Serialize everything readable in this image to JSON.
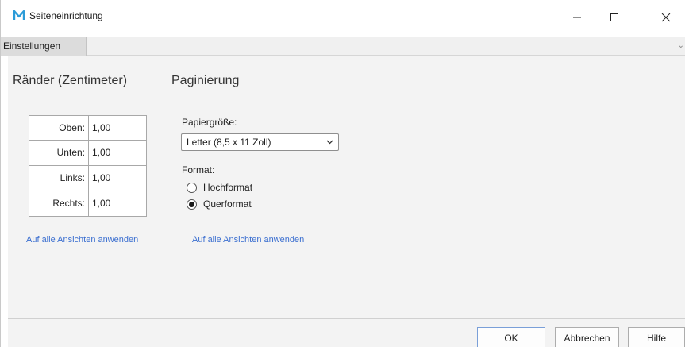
{
  "window": {
    "title": "Seiteneinrichtung",
    "logo_icon": "app-m-logo-icon",
    "controls": {
      "minimize_icon": "minimize-icon",
      "maximize_icon": "maximize-icon",
      "close_icon": "close-icon"
    }
  },
  "tabs": [
    {
      "label": "Einstellungen",
      "selected": true
    }
  ],
  "margins": {
    "title": "Ränder (Zentimeter)",
    "rows": [
      {
        "label": "Oben:",
        "value": "1,00"
      },
      {
        "label": "Unten:",
        "value": "1,00"
      },
      {
        "label": "Links:",
        "value": "1,00"
      },
      {
        "label": "Rechts:",
        "value": "1,00"
      }
    ],
    "apply_link": "Auf alle Ansichten anwenden"
  },
  "pagination": {
    "title": "Paginierung",
    "paper_size_label": "Papiergröße:",
    "paper_size_value": "Letter (8,5 x 11 Zoll)",
    "format_label": "Format:",
    "orientation_options": [
      {
        "label": "Hochformat",
        "checked": false
      },
      {
        "label": "Querformat",
        "checked": true
      }
    ],
    "apply_link": "Auf alle Ansichten anwenden"
  },
  "footer": {
    "ok_label": "OK",
    "cancel_label": "Abbrechen",
    "help_label": "Hilfe"
  },
  "colors": {
    "accent_link": "#3b6fd0",
    "logo": "#2b9bd8"
  }
}
